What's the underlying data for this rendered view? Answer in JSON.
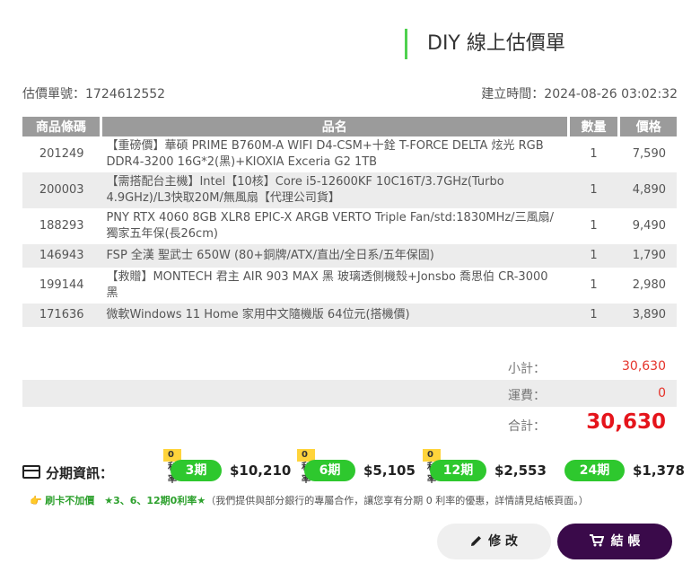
{
  "title": "DIY 線上估價單",
  "quote_no": "估價單號：1724612552",
  "created": "建立時間：2024-08-26 03:02:32",
  "headers": {
    "code": "商品條碼",
    "name": "品名",
    "qty": "數量",
    "price": "價格"
  },
  "items": [
    {
      "code": "201249",
      "name": "【重磅價】華碩 PRIME B760M-A WIFI D4-CSM+十銓 T-FORCE DELTA 炫光 RGB DDR4-3200 16G*2(黑)+KIOXIA Exceria G2 1TB",
      "qty": "1",
      "price": "7,590"
    },
    {
      "code": "200003",
      "name": "【需搭配台主機】Intel【10核】Core i5-12600KF 10C16T/3.7GHz(Turbo 4.9GHz)/L3快取20M/無風扇【代理公司貨】",
      "qty": "1",
      "price": "4,890"
    },
    {
      "code": "188293",
      "name": "PNY RTX 4060 8GB XLR8 EPIC-X ARGB VERTO Triple Fan/std:1830MHz/三風扇/獨家五年保(長26cm)",
      "qty": "1",
      "price": "9,490"
    },
    {
      "code": "146943",
      "name": "FSP 全漢 聖武士 650W (80+銅牌/ATX/直出/全日系/五年保固)",
      "qty": "1",
      "price": "1,790"
    },
    {
      "code": "199144",
      "name": "【救贈】MONTECH 君主 AIR 903 MAX 黑 玻璃透側機殼+Jonsbo 喬思伯 CR-3000 黑",
      "qty": "1",
      "price": "2,980"
    },
    {
      "code": "171636",
      "name": "微軟Windows 11 Home 家用中文隨機版 64位元(搭機價)",
      "qty": "1",
      "price": "3,890"
    }
  ],
  "summary": {
    "subtotal_label": "小計：",
    "subtotal": "30,630",
    "shipping_label": "運費：",
    "shipping": "0",
    "total_label": "合計：",
    "total": "30,630"
  },
  "installment": {
    "label": "分期資訊：",
    "plans": [
      {
        "badge": "0利率",
        "period": "3期",
        "amount": "$10,210"
      },
      {
        "badge": "0利率",
        "period": "6期",
        "amount": "$5,105"
      },
      {
        "badge": "0利率",
        "period": "12期",
        "amount": "$2,553"
      },
      {
        "badge": "",
        "period": "24期",
        "amount": "$1,378"
      }
    ]
  },
  "note": {
    "hand": "👉",
    "highlight": "刷卡不加價　★3、6、12期0利率★",
    "text": "（我們提供與部分銀行的專屬合作，讓您享有分期 0 利率的優惠，詳情請見結帳頁面。）"
  },
  "buttons": {
    "edit": "修 改",
    "checkout": "結 帳"
  },
  "colors": {
    "accent_green": "#2ec82e",
    "total_red": "#e5141b",
    "checkout_purple": "#3a0a4a",
    "badge_yellow": "#ffd43b"
  }
}
